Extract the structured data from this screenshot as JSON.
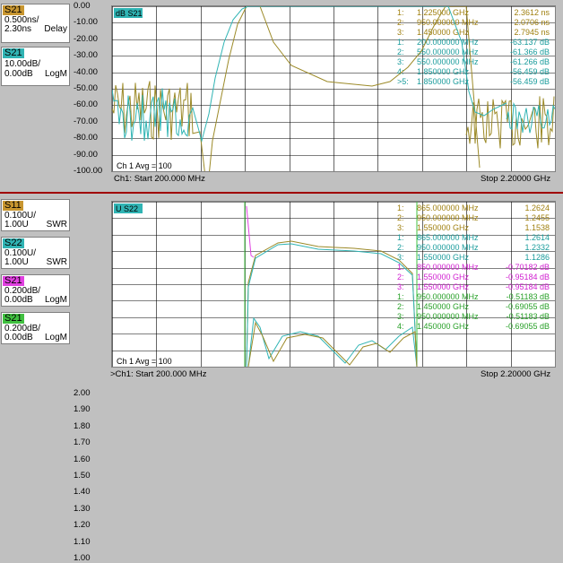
{
  "top": {
    "traces": [
      {
        "name": "S21",
        "line1": "0.500ns/",
        "line2": "2.30ns",
        "format": "Delay",
        "color": "#c89630"
      },
      {
        "name": "S21",
        "line1": "10.00dB/",
        "line2": "0.00dB",
        "format": "LogM",
        "color": "#30b4b4"
      }
    ],
    "y_ticks": [
      "0.00",
      "-10.00",
      "-20.00",
      "-30.00",
      "-40.00",
      "-50.00",
      "-60.00",
      "-70.00",
      "-80.00",
      "-90.00",
      "-100.00"
    ],
    "active_label": "dB S21",
    "avg_label": "Ch 1 Avg = 100",
    "start_label": "Ch1: Start 200.000 MHz",
    "stop_label": "Stop 2.20000 GHz",
    "markers": [
      {
        "idx": "1:",
        "freq": "1.225000 GHz",
        "val": "2.3612 ns",
        "color": "#a08010"
      },
      {
        "idx": "2:",
        "freq": "950.000000 MHz",
        "val": "2.0706 ns",
        "color": "#a08010"
      },
      {
        "idx": "3:",
        "freq": "1.450000 GHz",
        "val": "2.7945 ns",
        "color": "#a08010"
      },
      {
        "idx": "1:",
        "freq": "200.000000 MHz",
        "val": "-63.137 dB",
        "color": "#1a9c9c"
      },
      {
        "idx": "2:",
        "freq": "550.000000 MHz",
        "val": "-61.366 dB",
        "color": "#1a9c9c"
      },
      {
        "idx": "3:",
        "freq": "550.000000 MHz",
        "val": "-61.266 dB",
        "color": "#1a9c9c"
      },
      {
        "idx": "4:",
        "freq": "1.850000 GHz",
        "val": "-56.459 dB",
        "color": "#1a9c9c"
      },
      {
        "idx": ">5:",
        "freq": "1.850000 GHz",
        "val": "-56.459 dB",
        "color": "#1a9c9c"
      }
    ]
  },
  "bottom": {
    "traces": [
      {
        "name": "S11",
        "line1": "0.100U/",
        "line2": "1.00U",
        "format": "SWR",
        "color": "#c89630"
      },
      {
        "name": "S22",
        "line1": "0.100U/",
        "line2": "1.00U",
        "format": "SWR",
        "color": "#30b4b4"
      },
      {
        "name": "S21",
        "line1": "0.200dB/",
        "line2": "0.00dB",
        "format": "LogM",
        "color": "#e040e0"
      },
      {
        "name": "S21",
        "line1": "0.200dB/",
        "line2": "0.00dB",
        "format": "LogM",
        "color": "#40c040"
      }
    ],
    "y_ticks": [
      "2.00",
      "1.90",
      "1.80",
      "1.70",
      "1.60",
      "1.50",
      "1.40",
      "1.30",
      "1.20",
      "1.10",
      "1.00"
    ],
    "active_label": "U S22",
    "avg_label": "Ch 1 Avg = 100",
    "start_label": ">Ch1: Start 200.000 MHz",
    "stop_label": "Stop 2.20000 GHz",
    "markers": [
      {
        "idx": "1:",
        "freq": "865.000000 MHz",
        "val": "1.2624",
        "color": "#a08010"
      },
      {
        "idx": "2:",
        "freq": "950.000000 MHz",
        "val": "1.2455",
        "color": "#a08010"
      },
      {
        "idx": "3:",
        "freq": "1.550000 GHz",
        "val": "1.1538",
        "color": "#a08010"
      },
      {
        "idx": "1:",
        "freq": "865.000000 MHz",
        "val": "1.2614",
        "color": "#1a9c9c"
      },
      {
        "idx": "2:",
        "freq": "950.000000 MHz",
        "val": "1.2332",
        "color": "#1a9c9c"
      },
      {
        "idx": "3:",
        "freq": "1.550000 GHz",
        "val": "1.1286",
        "color": "#1a9c9c"
      },
      {
        "idx": "1:",
        "freq": "850.000000 MHz",
        "val": "-0.70182 dB",
        "color": "#d020d0"
      },
      {
        "idx": "2:",
        "freq": "1.550000 GHz",
        "val": "-0.95184 dB",
        "color": "#d020d0"
      },
      {
        "idx": "3:",
        "freq": "1.550000 GHz",
        "val": "-0.95184 dB",
        "color": "#d020d0"
      },
      {
        "idx": "1:",
        "freq": "950.000000 MHz",
        "val": "-0.51183 dB",
        "color": "#28a028"
      },
      {
        "idx": "2:",
        "freq": "1.450000 GHz",
        "val": "-0.69055 dB",
        "color": "#28a028"
      },
      {
        "idx": "3:",
        "freq": "950.000000 MHz",
        "val": "-0.51183 dB",
        "color": "#28a028"
      },
      {
        "idx": "4:",
        "freq": "1.450000 GHz",
        "val": "-0.69055 dB",
        "color": "#28a028"
      }
    ]
  }
}
